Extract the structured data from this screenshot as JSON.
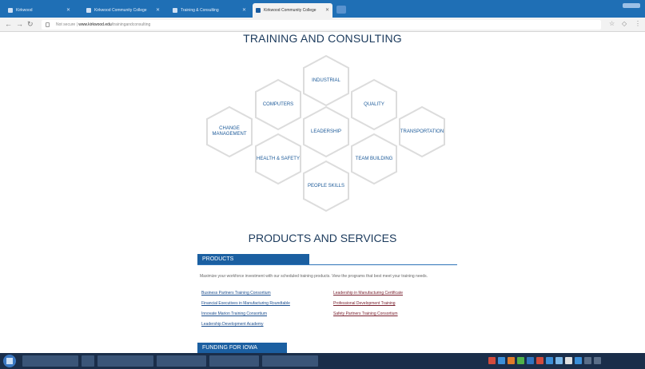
{
  "browser": {
    "tabs": [
      {
        "label": "Kirkwood"
      },
      {
        "label": "Kirkwood Community College"
      },
      {
        "label": "Training & Consulting"
      },
      {
        "label": "Kirkwood Community College"
      }
    ],
    "url_prefix": "Not secure",
    "url_host": "www.kirkwood.edu",
    "url_path": "/trainingandconsulting"
  },
  "colors": {
    "brand_blue": "#1b5fa1",
    "heading": "#1b3a5c",
    "hex_label": "#1c5a99"
  },
  "training": {
    "title": "TRAINING AND CONSULTING",
    "hexes": [
      {
        "label": "INDUSTRIAL"
      },
      {
        "label": "COMPUTERS"
      },
      {
        "label": "QUALITY"
      },
      {
        "label": "CHANGE MANAGEMENT"
      },
      {
        "label": "LEADERSHIP"
      },
      {
        "label": "TRANSPORTATION"
      },
      {
        "label": "HEALTH & SAFETY"
      },
      {
        "label": "TEAM BUILDING"
      },
      {
        "label": "PEOPLE SKILLS"
      }
    ]
  },
  "products": {
    "title": "PRODUCTS AND SERVICES",
    "section_label": "PRODUCTS",
    "description": "Maximize your workforce investment with our scheduled training products. View the programs that best meet your training needs.",
    "links_left": [
      "Business Partners Training Consortium",
      "Financial Executives in Manufacturing Roundtable",
      "Innovate Marion Training Consortium",
      "Leadership Development Academy"
    ],
    "links_right": [
      "Leadership in Manufacturing Certificate",
      "Professional Development Training",
      "Safety Partners Training Consortium"
    ]
  },
  "funding": {
    "section_label": "FUNDING FOR IOWA BUSINESSES"
  }
}
